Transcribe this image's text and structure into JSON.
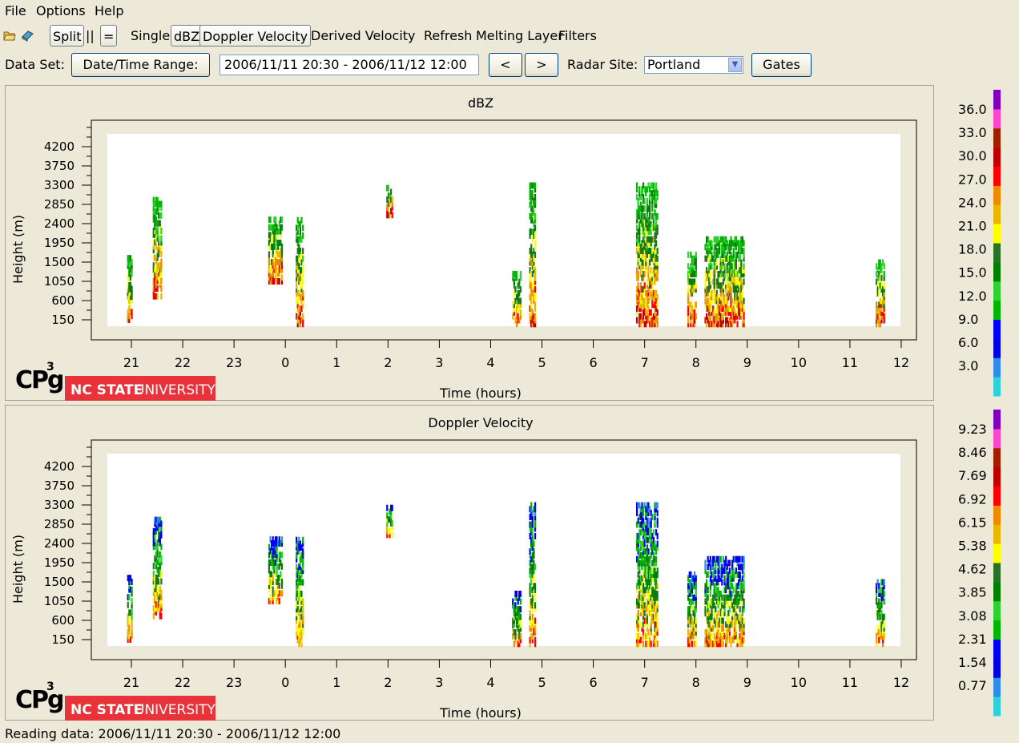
{
  "menu": {
    "file": "File",
    "options": "Options",
    "help": "Help"
  },
  "toolbar": {
    "split": "Split",
    "pause": "||",
    "equals": "=",
    "single": "Single",
    "dbz": "dBZ",
    "doppler": "Doppler Velocity",
    "derived": "Derived Velocity",
    "refresh": "Refresh",
    "melting": "Melting Layer",
    "filters": "Filters"
  },
  "dataset": {
    "label": "Data Set:",
    "range_button": "Date/Time Range:",
    "range_value": "2006/11/11 20:30 - 2006/11/12 12:00",
    "prev": "<",
    "next": ">",
    "site_label": "Radar Site:",
    "site_value": "Portland",
    "gates": "Gates"
  },
  "branding": {
    "cpg": "CPg",
    "sup": "3",
    "ncsu_bold": "NC STATE",
    "ncsu_light": "UNIVERSITY"
  },
  "status": "Reading data: 2006/11/11 20:30 - 2006/11/12 12:00",
  "colors": {
    "scale": [
      "#2fd0d8",
      "#2f8ce8",
      "#0000e0",
      "#0000ff",
      "#00b800",
      "#2fd02f",
      "#008000",
      "#267326",
      "#ffff00",
      "#e8b800",
      "#f08a00",
      "#ff0000",
      "#c00000",
      "#a02000",
      "#ff44cc",
      "#8000c0"
    ]
  },
  "chart_data": [
    {
      "type": "heatmap",
      "title": "dBZ",
      "xlabel": "Time (hours)",
      "ylabel": "Height (m)",
      "x_ticks": [
        "21",
        "22",
        "23",
        "0",
        "1",
        "2",
        "3",
        "4",
        "5",
        "6",
        "7",
        "8",
        "9",
        "10",
        "11",
        "12"
      ],
      "y_ticks": [
        "150",
        "600",
        "1050",
        "1500",
        "1950",
        "2400",
        "2850",
        "3300",
        "3750",
        "4200"
      ],
      "colorbar_labels": [
        "36.0",
        "33.0",
        "30.0",
        "27.0",
        "24.0",
        "21.0",
        "18.0",
        "15.0",
        "12.0",
        "9.0",
        "6.0",
        "3.0"
      ],
      "echo_clusters": [
        {
          "t_start": "20:55",
          "t_end": "21:00",
          "h_min": 150,
          "h_max": 1650
        },
        {
          "t_start": "21:25",
          "t_end": "21:35",
          "h_min": 700,
          "h_max": 2950
        },
        {
          "t_start": "23:40",
          "t_end": "23:55",
          "h_min": 1050,
          "h_max": 2500
        },
        {
          "t_start": "00:12",
          "t_end": "00:20",
          "h_min": 50,
          "h_max": 2550
        },
        {
          "t_start": "01:58",
          "t_end": "02:05",
          "h_min": 2600,
          "h_max": 3300
        },
        {
          "t_start": "04:25",
          "t_end": "04:35",
          "h_min": 50,
          "h_max": 1250
        },
        {
          "t_start": "04:45",
          "t_end": "04:52",
          "h_min": 50,
          "h_max": 3300
        },
        {
          "t_start": "06:50",
          "t_end": "07:15",
          "h_min": 50,
          "h_max": 3300
        },
        {
          "t_start": "07:50",
          "t_end": "08:00",
          "h_min": 50,
          "h_max": 1750
        },
        {
          "t_start": "08:10",
          "t_end": "08:55",
          "h_min": 50,
          "h_max": 2050
        },
        {
          "t_start": "11:30",
          "t_end": "11:40",
          "h_min": 50,
          "h_max": 1550
        }
      ]
    },
    {
      "type": "heatmap",
      "title": "Doppler Velocity",
      "xlabel": "Time (hours)",
      "ylabel": "Height (m)",
      "x_ticks": [
        "21",
        "22",
        "23",
        "0",
        "1",
        "2",
        "3",
        "4",
        "5",
        "6",
        "7",
        "8",
        "9",
        "10",
        "11",
        "12"
      ],
      "y_ticks": [
        "150",
        "600",
        "1050",
        "1500",
        "1950",
        "2400",
        "2850",
        "3300",
        "3750",
        "4200"
      ],
      "colorbar_labels": [
        "9.23",
        "8.46",
        "7.69",
        "6.92",
        "6.15",
        "5.38",
        "4.62",
        "3.85",
        "3.08",
        "2.31",
        "1.54",
        "0.77"
      ],
      "echo_clusters": [
        {
          "t_start": "20:55",
          "t_end": "21:00",
          "h_min": 150,
          "h_max": 1650
        },
        {
          "t_start": "21:25",
          "t_end": "21:35",
          "h_min": 700,
          "h_max": 2950
        },
        {
          "t_start": "23:40",
          "t_end": "23:55",
          "h_min": 1050,
          "h_max": 2500
        },
        {
          "t_start": "00:12",
          "t_end": "00:20",
          "h_min": 50,
          "h_max": 2550
        },
        {
          "t_start": "01:58",
          "t_end": "02:05",
          "h_min": 2600,
          "h_max": 3300
        },
        {
          "t_start": "04:25",
          "t_end": "04:35",
          "h_min": 50,
          "h_max": 1250
        },
        {
          "t_start": "04:45",
          "t_end": "04:52",
          "h_min": 50,
          "h_max": 3300
        },
        {
          "t_start": "06:50",
          "t_end": "07:15",
          "h_min": 50,
          "h_max": 3300
        },
        {
          "t_start": "07:50",
          "t_end": "08:00",
          "h_min": 50,
          "h_max": 1750
        },
        {
          "t_start": "08:10",
          "t_end": "08:55",
          "h_min": 50,
          "h_max": 2050
        },
        {
          "t_start": "11:30",
          "t_end": "11:40",
          "h_min": 50,
          "h_max": 1550
        }
      ]
    }
  ]
}
